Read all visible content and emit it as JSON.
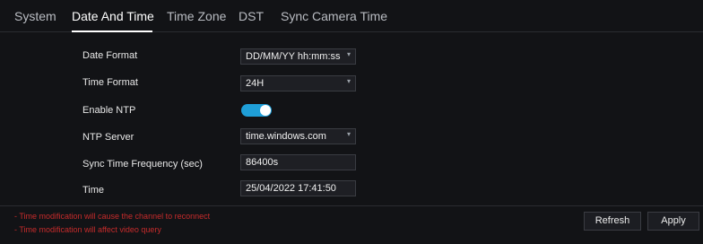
{
  "tabs": [
    {
      "label": "System"
    },
    {
      "label": "Date And Time"
    },
    {
      "label": "Time Zone"
    },
    {
      "label": "DST"
    },
    {
      "label": "Sync Camera Time"
    }
  ],
  "form": {
    "date_format": {
      "label": "Date Format",
      "value": "DD/MM/YY hh:mm:ss"
    },
    "time_format": {
      "label": "Time Format",
      "value": "24H"
    },
    "enable_ntp": {
      "label": "Enable NTP",
      "value": true
    },
    "ntp_server": {
      "label": "NTP Server",
      "value": "time.windows.com"
    },
    "sync_frequency": {
      "label": "Sync Time Frequency (sec)",
      "value": "86400s"
    },
    "time": {
      "label": "Time",
      "value": "25/04/2022 17:41:50"
    }
  },
  "notes": [
    "- Time modification will cause the channel to reconnect",
    "- Time modification will affect video query"
  ],
  "buttons": {
    "refresh": "Refresh",
    "apply": "Apply"
  },
  "colors": {
    "accent": "#1f9fd8",
    "warning": "#c62b2b",
    "background": "#121316"
  }
}
